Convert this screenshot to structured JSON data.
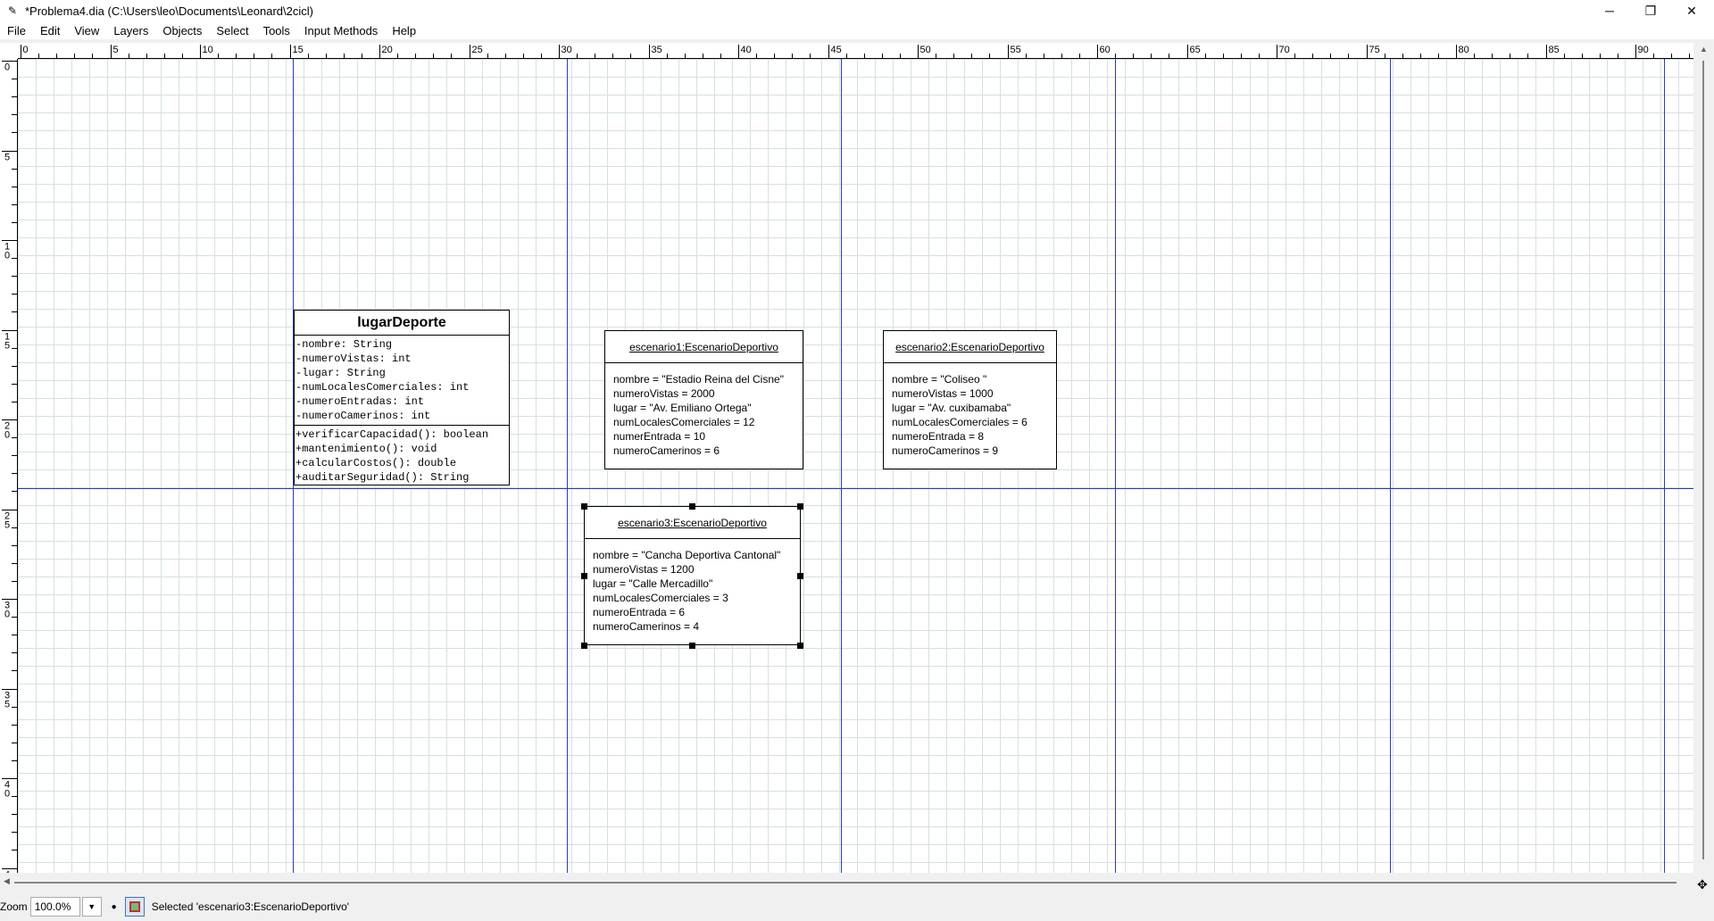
{
  "window": {
    "title": "*Problema4.dia (C:\\Users\\leo\\Documents\\Leonard\\2cicl)",
    "app_icon": "dia-icon",
    "minimize": "─",
    "maximize": "❐",
    "close": "✕"
  },
  "menu": [
    "File",
    "Edit",
    "View",
    "Layers",
    "Objects",
    "Select",
    "Tools",
    "Input Methods",
    "Help"
  ],
  "ruler_h": [
    "0",
    "5",
    "10",
    "15",
    "20",
    "25",
    "30",
    "35",
    "40",
    "45",
    "50",
    "55",
    "60",
    "65",
    "70",
    "75",
    "80",
    "85",
    "90"
  ],
  "ruler_v": [
    "0",
    "5",
    "1\n0",
    "1\n5",
    "2\n0",
    "2\n5",
    "3\n0",
    "3\n5",
    "4\n0",
    "4"
  ],
  "class": {
    "name": "lugarDeporte",
    "attributes": [
      "-nombre: String",
      "-numeroVistas: int",
      "-lugar: String",
      "-numLocalesComerciales: int",
      "-numeroEntradas: int",
      "-numeroCamerinos: int"
    ],
    "operations": [
      "+verificarCapacidad(): boolean",
      "+mantenimiento(): void",
      "+calcularCostos(): double",
      "+auditarSeguridad(): String"
    ]
  },
  "objects": [
    {
      "name": "escenario1:EscenarioDeportivo",
      "attrs": [
        "nombre = \"Estadio Reina del Cisne\"",
        "numeroVistas = 2000",
        "lugar = \"Av. Emiliano Ortega\"",
        "numLocalesComerciales = 12",
        "numerEntrada = 10",
        "numeroCamerinos = 6"
      ]
    },
    {
      "name": "escenario2:EscenarioDeportivo",
      "attrs": [
        "nombre = \"Coliseo \"",
        "numeroVistas = 1000",
        "lugar = \"Av. cuxibamaba\"",
        "numLocalesComerciales = 6",
        "numeroEntrada = 8",
        "numeroCamerinos = 9"
      ]
    },
    {
      "name": "escenario3:EscenarioDeportivo",
      "attrs": [
        "nombre = \"Cancha Deportiva Cantonal\"",
        "numeroVistas = 1200",
        "lugar = \"Calle Mercadillo\"",
        "numLocalesComerciales = 3",
        "numeroEntrada = 6",
        "numeroCamerinos = 4"
      ]
    }
  ],
  "status": {
    "zoom_label": "Zoom",
    "zoom_value": "100.0%",
    "message": "Selected 'escenario3:EscenarioDeportivo'"
  },
  "colors": {
    "guide": "#2b3db0",
    "grid": "#d4e0e4"
  }
}
